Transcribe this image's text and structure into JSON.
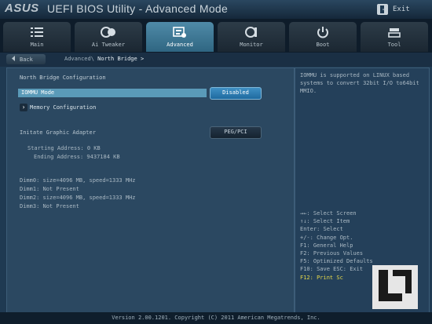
{
  "titlebar": {
    "logo": "ASUS",
    "title": "UEFI BIOS Utility - Advanced Mode",
    "exit_label": "Exit"
  },
  "tabs": [
    {
      "label": "Main",
      "icon": "list-icon"
    },
    {
      "label": "Ai Tweaker",
      "icon": "ai-tweaker-icon"
    },
    {
      "label": "Advanced",
      "icon": "advanced-icon",
      "active": true
    },
    {
      "label": "Monitor",
      "icon": "monitor-icon"
    },
    {
      "label": "Boot",
      "icon": "power-icon"
    },
    {
      "label": "Tool",
      "icon": "tool-icon"
    }
  ],
  "breadcrumb": {
    "back_label": "Back",
    "path": "Advanced\\",
    "current": "North Bridge >"
  },
  "main": {
    "section_title": "North Bridge Configuration",
    "iommu": {
      "label": "IOMMU Mode",
      "value": "Disabled"
    },
    "memory_config": "Memory Configuration",
    "adapter": {
      "label": "Initate Graphic Adapter",
      "value": "PEG/PCI"
    },
    "start_address": "Starting Address: 0 KB",
    "end_address": "Ending Address: 9437184 KB",
    "dimms": [
      "Dimm0: size=4096 MB, speed=1333 MHz",
      "Dimm1: Not Present",
      "Dimm2: size=4096 MB, speed=1333 MHz",
      "Dimm3: Not Present"
    ]
  },
  "help": {
    "text": "IOMMU is supported on LINUX based systems to convert 32bit I/O to64bit MMIO.",
    "keys": [
      "→←: Select Screen",
      "↑↓: Select Item",
      "Enter: Select",
      "+/-: Change Opt.",
      "F1: General Help",
      "F2: Previous Values",
      "F5: Optimized Defaults",
      "F10: Save  ESC: Exit",
      "F12: Print Sc"
    ]
  },
  "footer": "Version 2.00.1201. Copyright (C) 2011 American Megatrends, Inc.",
  "colors": {
    "accent": "#5a9ab8",
    "highlight_key": "#e6d84a",
    "background": "#1f3a52"
  }
}
